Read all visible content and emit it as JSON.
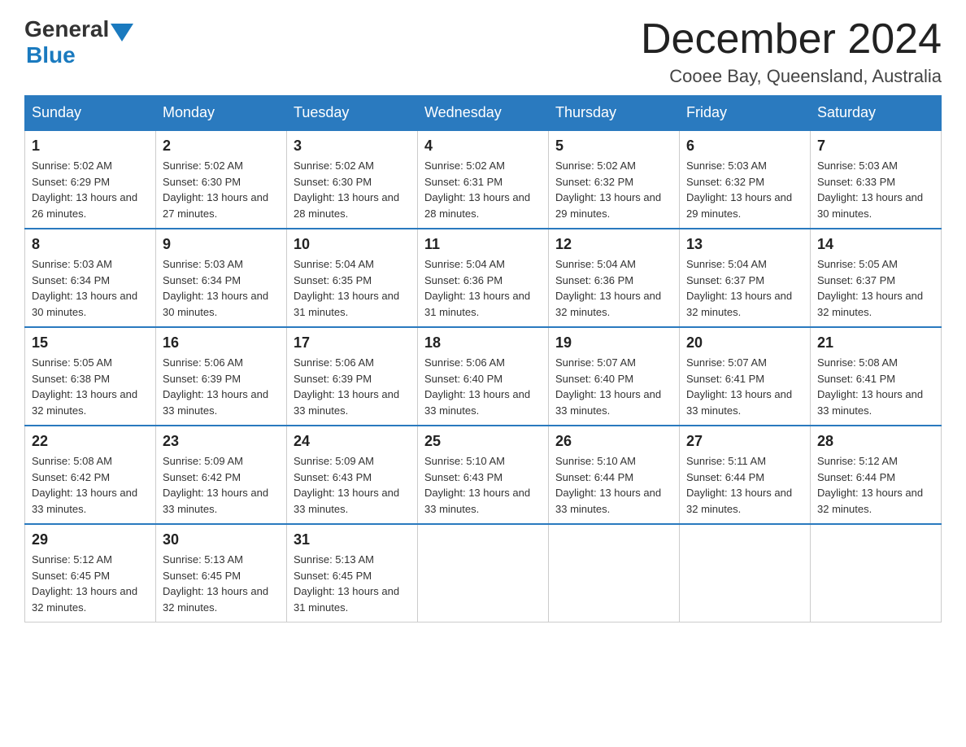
{
  "header": {
    "logo_general": "General",
    "logo_blue": "Blue",
    "title": "December 2024",
    "subtitle": "Cooee Bay, Queensland, Australia"
  },
  "columns": [
    "Sunday",
    "Monday",
    "Tuesday",
    "Wednesday",
    "Thursday",
    "Friday",
    "Saturday"
  ],
  "weeks": [
    [
      {
        "day": "1",
        "sunrise": "Sunrise: 5:02 AM",
        "sunset": "Sunset: 6:29 PM",
        "daylight": "Daylight: 13 hours and 26 minutes."
      },
      {
        "day": "2",
        "sunrise": "Sunrise: 5:02 AM",
        "sunset": "Sunset: 6:30 PM",
        "daylight": "Daylight: 13 hours and 27 minutes."
      },
      {
        "day": "3",
        "sunrise": "Sunrise: 5:02 AM",
        "sunset": "Sunset: 6:30 PM",
        "daylight": "Daylight: 13 hours and 28 minutes."
      },
      {
        "day": "4",
        "sunrise": "Sunrise: 5:02 AM",
        "sunset": "Sunset: 6:31 PM",
        "daylight": "Daylight: 13 hours and 28 minutes."
      },
      {
        "day": "5",
        "sunrise": "Sunrise: 5:02 AM",
        "sunset": "Sunset: 6:32 PM",
        "daylight": "Daylight: 13 hours and 29 minutes."
      },
      {
        "day": "6",
        "sunrise": "Sunrise: 5:03 AM",
        "sunset": "Sunset: 6:32 PM",
        "daylight": "Daylight: 13 hours and 29 minutes."
      },
      {
        "day": "7",
        "sunrise": "Sunrise: 5:03 AM",
        "sunset": "Sunset: 6:33 PM",
        "daylight": "Daylight: 13 hours and 30 minutes."
      }
    ],
    [
      {
        "day": "8",
        "sunrise": "Sunrise: 5:03 AM",
        "sunset": "Sunset: 6:34 PM",
        "daylight": "Daylight: 13 hours and 30 minutes."
      },
      {
        "day": "9",
        "sunrise": "Sunrise: 5:03 AM",
        "sunset": "Sunset: 6:34 PM",
        "daylight": "Daylight: 13 hours and 30 minutes."
      },
      {
        "day": "10",
        "sunrise": "Sunrise: 5:04 AM",
        "sunset": "Sunset: 6:35 PM",
        "daylight": "Daylight: 13 hours and 31 minutes."
      },
      {
        "day": "11",
        "sunrise": "Sunrise: 5:04 AM",
        "sunset": "Sunset: 6:36 PM",
        "daylight": "Daylight: 13 hours and 31 minutes."
      },
      {
        "day": "12",
        "sunrise": "Sunrise: 5:04 AM",
        "sunset": "Sunset: 6:36 PM",
        "daylight": "Daylight: 13 hours and 32 minutes."
      },
      {
        "day": "13",
        "sunrise": "Sunrise: 5:04 AM",
        "sunset": "Sunset: 6:37 PM",
        "daylight": "Daylight: 13 hours and 32 minutes."
      },
      {
        "day": "14",
        "sunrise": "Sunrise: 5:05 AM",
        "sunset": "Sunset: 6:37 PM",
        "daylight": "Daylight: 13 hours and 32 minutes."
      }
    ],
    [
      {
        "day": "15",
        "sunrise": "Sunrise: 5:05 AM",
        "sunset": "Sunset: 6:38 PM",
        "daylight": "Daylight: 13 hours and 32 minutes."
      },
      {
        "day": "16",
        "sunrise": "Sunrise: 5:06 AM",
        "sunset": "Sunset: 6:39 PM",
        "daylight": "Daylight: 13 hours and 33 minutes."
      },
      {
        "day": "17",
        "sunrise": "Sunrise: 5:06 AM",
        "sunset": "Sunset: 6:39 PM",
        "daylight": "Daylight: 13 hours and 33 minutes."
      },
      {
        "day": "18",
        "sunrise": "Sunrise: 5:06 AM",
        "sunset": "Sunset: 6:40 PM",
        "daylight": "Daylight: 13 hours and 33 minutes."
      },
      {
        "day": "19",
        "sunrise": "Sunrise: 5:07 AM",
        "sunset": "Sunset: 6:40 PM",
        "daylight": "Daylight: 13 hours and 33 minutes."
      },
      {
        "day": "20",
        "sunrise": "Sunrise: 5:07 AM",
        "sunset": "Sunset: 6:41 PM",
        "daylight": "Daylight: 13 hours and 33 minutes."
      },
      {
        "day": "21",
        "sunrise": "Sunrise: 5:08 AM",
        "sunset": "Sunset: 6:41 PM",
        "daylight": "Daylight: 13 hours and 33 minutes."
      }
    ],
    [
      {
        "day": "22",
        "sunrise": "Sunrise: 5:08 AM",
        "sunset": "Sunset: 6:42 PM",
        "daylight": "Daylight: 13 hours and 33 minutes."
      },
      {
        "day": "23",
        "sunrise": "Sunrise: 5:09 AM",
        "sunset": "Sunset: 6:42 PM",
        "daylight": "Daylight: 13 hours and 33 minutes."
      },
      {
        "day": "24",
        "sunrise": "Sunrise: 5:09 AM",
        "sunset": "Sunset: 6:43 PM",
        "daylight": "Daylight: 13 hours and 33 minutes."
      },
      {
        "day": "25",
        "sunrise": "Sunrise: 5:10 AM",
        "sunset": "Sunset: 6:43 PM",
        "daylight": "Daylight: 13 hours and 33 minutes."
      },
      {
        "day": "26",
        "sunrise": "Sunrise: 5:10 AM",
        "sunset": "Sunset: 6:44 PM",
        "daylight": "Daylight: 13 hours and 33 minutes."
      },
      {
        "day": "27",
        "sunrise": "Sunrise: 5:11 AM",
        "sunset": "Sunset: 6:44 PM",
        "daylight": "Daylight: 13 hours and 32 minutes."
      },
      {
        "day": "28",
        "sunrise": "Sunrise: 5:12 AM",
        "sunset": "Sunset: 6:44 PM",
        "daylight": "Daylight: 13 hours and 32 minutes."
      }
    ],
    [
      {
        "day": "29",
        "sunrise": "Sunrise: 5:12 AM",
        "sunset": "Sunset: 6:45 PM",
        "daylight": "Daylight: 13 hours and 32 minutes."
      },
      {
        "day": "30",
        "sunrise": "Sunrise: 5:13 AM",
        "sunset": "Sunset: 6:45 PM",
        "daylight": "Daylight: 13 hours and 32 minutes."
      },
      {
        "day": "31",
        "sunrise": "Sunrise: 5:13 AM",
        "sunset": "Sunset: 6:45 PM",
        "daylight": "Daylight: 13 hours and 31 minutes."
      },
      null,
      null,
      null,
      null
    ]
  ]
}
